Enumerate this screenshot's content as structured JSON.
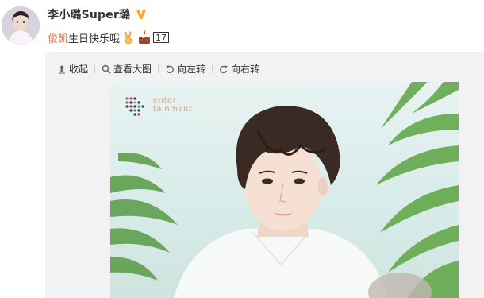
{
  "post": {
    "author": {
      "name": "李小璐Super璐"
    },
    "content": {
      "mention": "俊凯",
      "text": "生日快乐哦",
      "emoji_names": [
        "victory-hand-emoji",
        "birthday-cake-emoji"
      ],
      "trailing_symbol": "17"
    }
  },
  "media_toolbar": {
    "collapse_label": "收起",
    "view_large_label": "查看大图",
    "rotate_left_label": "向左转",
    "rotate_right_label": "向右转"
  },
  "photo": {
    "watermark_text_line1": "enter",
    "watermark_text_line2": "tainment"
  },
  "colors": {
    "mention": "#eb7350",
    "text": "#333333",
    "vip_badge": "#f6a623",
    "media_bg": "#f2f2f5"
  }
}
